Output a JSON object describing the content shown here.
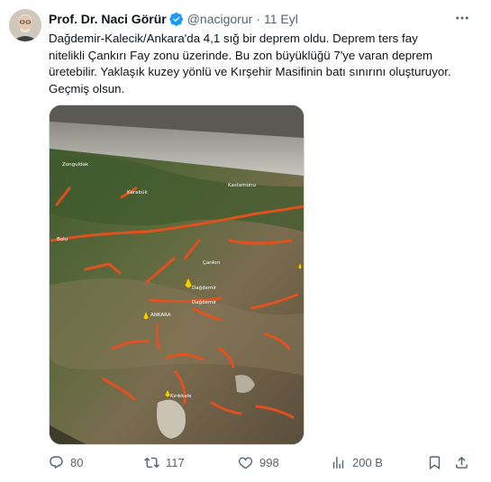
{
  "author": {
    "name": "Prof. Dr. Naci Görür",
    "handle": "@nacigorur",
    "date": "11 Eyl"
  },
  "tweet": {
    "lines": [
      "Dağdemir-Kalecik/Ankara'da 4,1 sığ bir deprem oldu. Deprem ters fay",
      "nitelikli Çankırı Fay zonu üzerinde. Bu zon büyüklüğü 7'ye varan deprem",
      "üretebilir. Yaklaşık kuzey yönlü ve Kırşehir Masifinin batı sınırını oluşturuyor.",
      "Geçmiş olsun."
    ]
  },
  "map_labels": {
    "zonguldak": "Zonguldak",
    "karabuk": "Karabük",
    "kastamonu": "Kastamonu",
    "bolu": "Bolu",
    "cankiri": "Çankırı",
    "dagdemir": "Dağdemir",
    "dagdemir2": "Dağdemir",
    "ankara": "ANKARA",
    "kirikkale": "Kırıkkale"
  },
  "actions": {
    "replies": "80",
    "retweets": "117",
    "likes": "998",
    "views": "200 B"
  },
  "colors": {
    "accent_verified": "#1d9bf0",
    "text_primary": "#0f1419",
    "text_secondary": "#536471",
    "fault_lines": "#e8501e",
    "pin": "#f5d000"
  },
  "icons": {
    "more": "more-dots-icon",
    "reply": "reply-icon",
    "retweet": "retweet-icon",
    "like": "heart-icon",
    "views": "views-icon",
    "bookmark": "bookmark-icon",
    "share": "share-icon"
  }
}
